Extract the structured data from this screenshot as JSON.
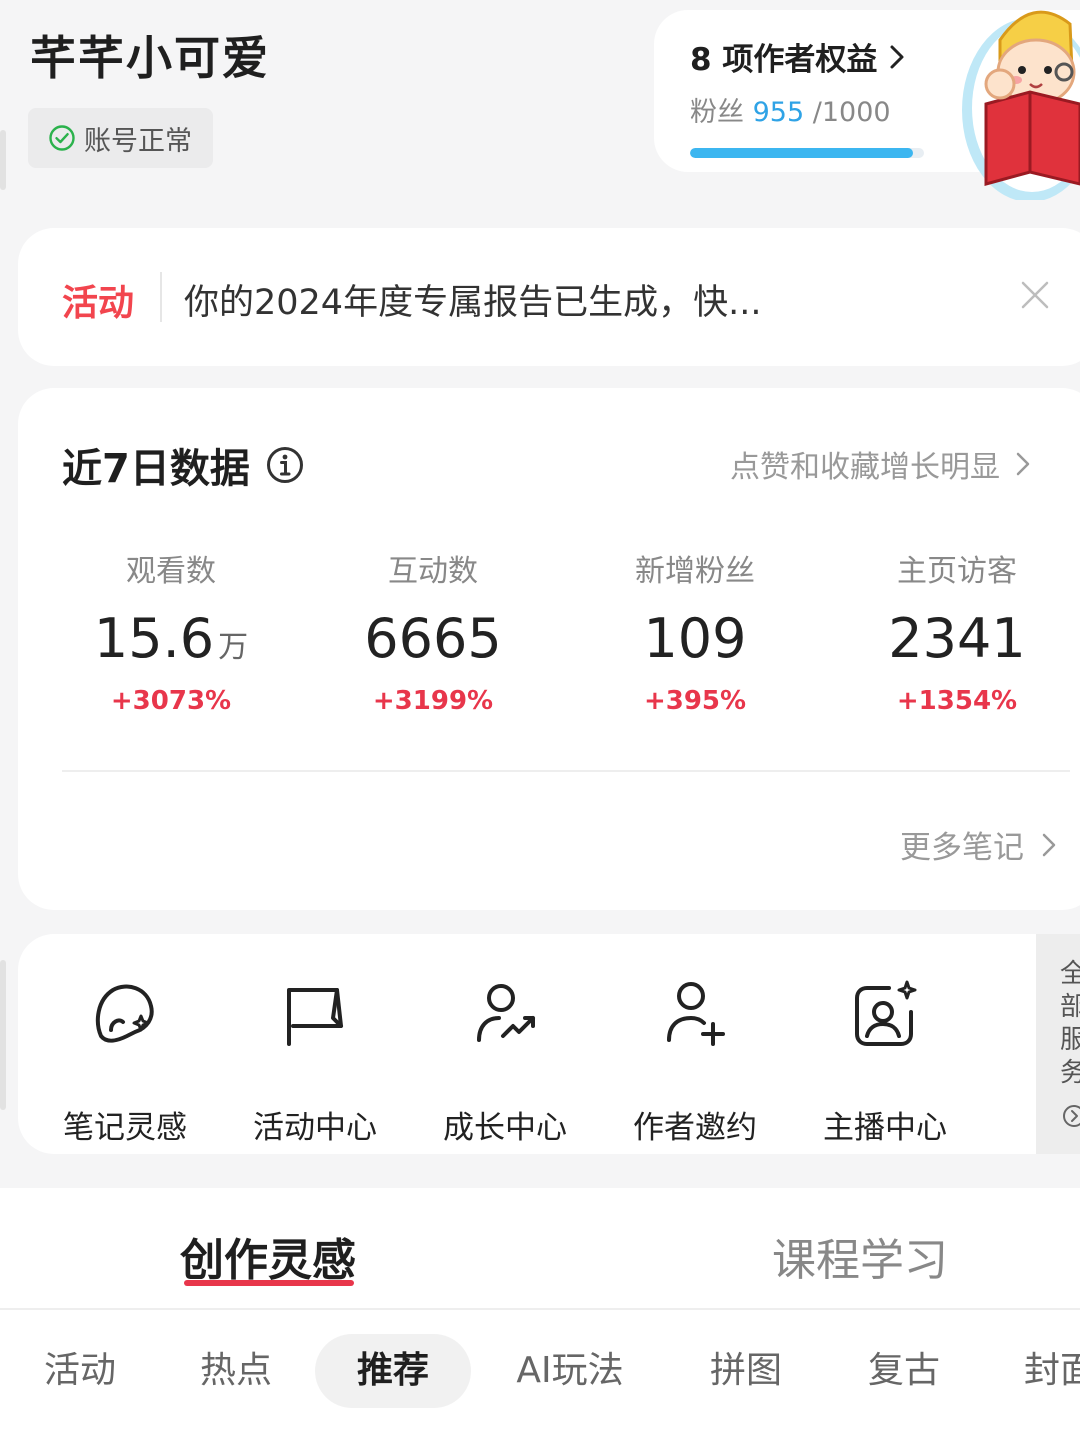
{
  "header": {
    "username": "芊芊小可爱",
    "account_status": "账号正常"
  },
  "benefits": {
    "title": "8 项作者权益",
    "fans_label": "粉丝",
    "fans_current": "955",
    "fans_target": "/1000",
    "fans_progress": 0.955
  },
  "activity": {
    "tag": "活动",
    "message": "你的2024年度专属报告已生成，快..."
  },
  "data7": {
    "title": "近7日数据",
    "hint": "点赞和收藏增长明显",
    "stats": [
      {
        "label": "观看数",
        "value": "15.6",
        "unit": "万",
        "change": "+3073%"
      },
      {
        "label": "互动数",
        "value": "6665",
        "unit": "",
        "change": "+3199%"
      },
      {
        "label": "新增粉丝",
        "value": "109",
        "unit": "",
        "change": "+395%"
      },
      {
        "label": "主页访客",
        "value": "2341",
        "unit": "",
        "change": "+1354%"
      }
    ],
    "more_notes": "更多笔记"
  },
  "services": {
    "items": [
      {
        "label": "笔记灵感",
        "icon": "lightbulb-head-icon"
      },
      {
        "label": "活动中心",
        "icon": "flag-icon"
      },
      {
        "label": "成长中心",
        "icon": "user-growth-icon"
      },
      {
        "label": "作者邀约",
        "icon": "user-add-icon"
      },
      {
        "label": "主播中心",
        "icon": "live-host-icon"
      }
    ],
    "all_label": "全部服务"
  },
  "tabs": {
    "main": [
      "创作灵感",
      "课程学习"
    ],
    "active_main": "创作灵感",
    "chips": [
      "活动",
      "热点",
      "推荐",
      "AI玩法",
      "拼图",
      "复古",
      "封面"
    ],
    "active_chip": "推荐"
  },
  "colors": {
    "accent_red": "#e8364b",
    "activity_red": "#f2454e",
    "fans_blue": "#2fa3e6",
    "status_green": "#2bb24c"
  }
}
